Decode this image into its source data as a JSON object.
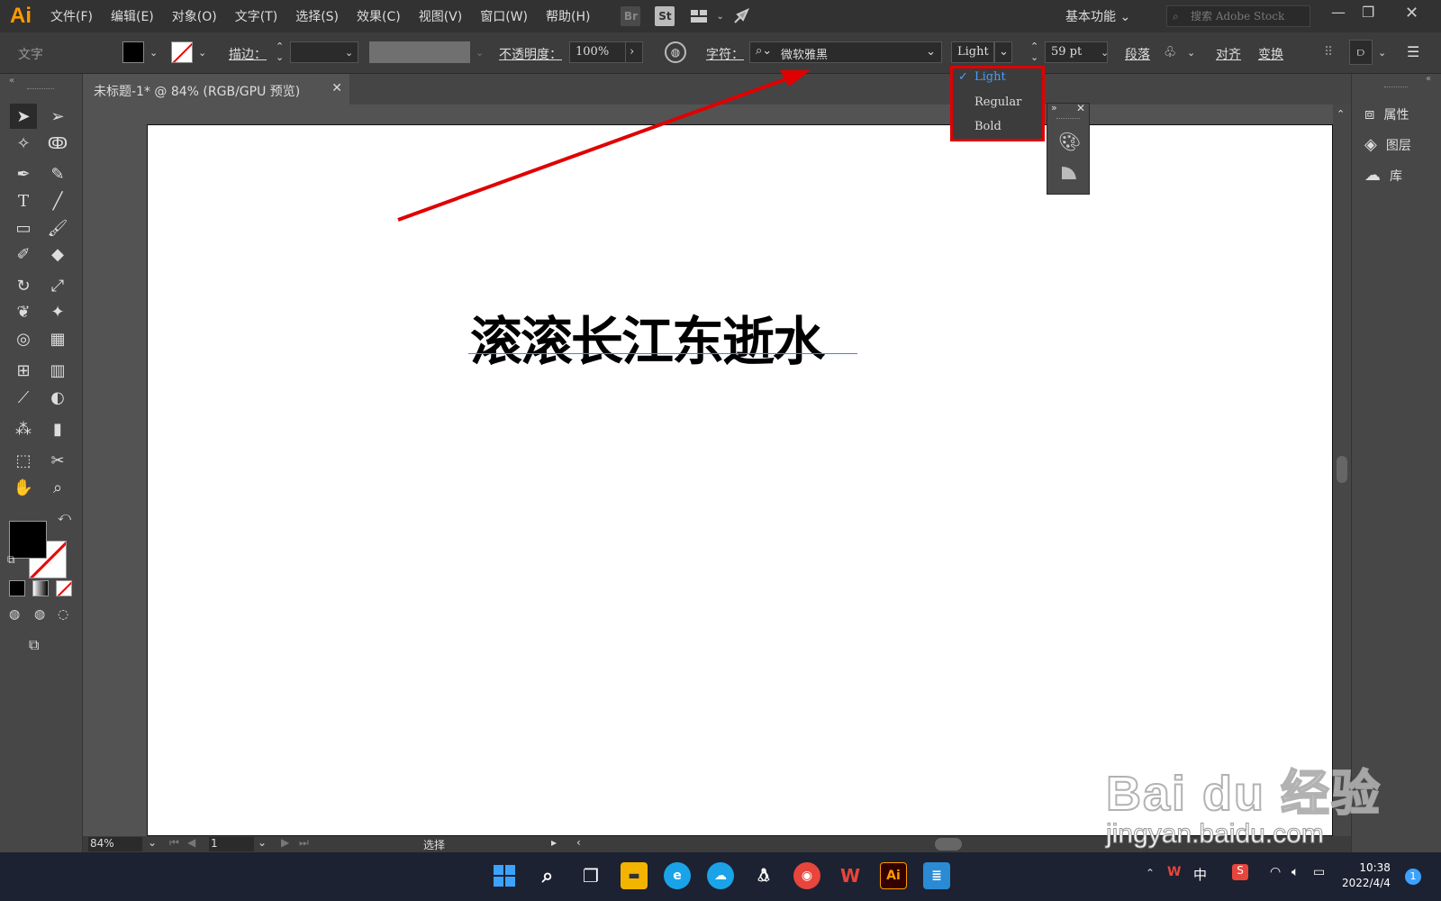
{
  "app": {
    "logo": "Ai"
  },
  "menubar": {
    "items": [
      "文件(F)",
      "编辑(E)",
      "对象(O)",
      "文字(T)",
      "选择(S)",
      "效果(C)",
      "视图(V)",
      "窗口(W)",
      "帮助(H)"
    ],
    "bridge_label": "Br",
    "stock_label": "St",
    "workspace": "基本功能",
    "search_placeholder": "搜索 Adobe Stock"
  },
  "control_bar": {
    "mode_label": "文字",
    "stroke_label": "描边：",
    "opacity_label": "不透明度：",
    "opacity_value": "100%",
    "char_label": "字符：",
    "font_family": "微软雅黑",
    "font_style": "Light",
    "font_size": "59 pt",
    "paragraph_label": "段落",
    "align_label": "对齐",
    "transform_label": "变换"
  },
  "font_style_dropdown": {
    "options": [
      "Light",
      "Regular",
      "Bold"
    ],
    "selected": "Light",
    "check": "✓"
  },
  "document": {
    "tab_title": "未标题-1* @ 84% (RGB/GPU 预览)",
    "headline": "滚滚长江东逝水"
  },
  "right_panel": {
    "items": [
      "属性",
      "图层",
      "库"
    ]
  },
  "status_bar": {
    "zoom": "84%",
    "page": "1",
    "tool_status": "选择"
  },
  "taskbar": {
    "ime": "中",
    "time": "10:38",
    "date": "2022/4/4",
    "notifications": "1"
  },
  "watermark": {
    "brand": "Bai du 经验",
    "url": "jingyan.baidu.com"
  },
  "colors": {
    "annotation": "#e00000",
    "accent_blue": "#4a9cff",
    "ai_orange": "#ff9a00"
  }
}
